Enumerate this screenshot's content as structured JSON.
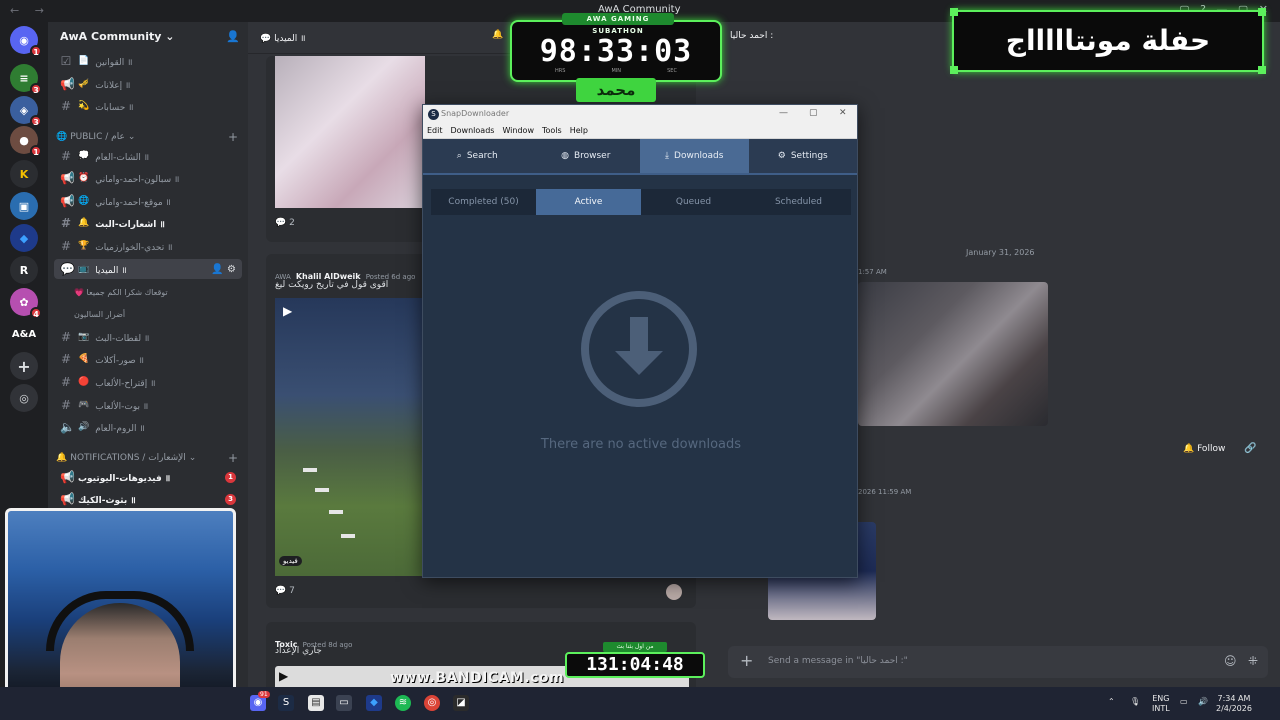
{
  "window": {
    "title": "AwA Community"
  },
  "rail": {
    "badges": [
      "1",
      "3",
      "3",
      "1",
      "4"
    ],
    "label": "A&A"
  },
  "sidebar": {
    "server_name": "AwA Community",
    "top_channels": [
      {
        "label": "القوانين ॥",
        "emoji": "📄"
      },
      {
        "label": "إعلانات ॥",
        "emoji": "🎺"
      },
      {
        "label": "حسابات ॥",
        "emoji": "💫"
      }
    ],
    "public_category": "PUBLIC / عام",
    "public_channels": [
      {
        "label": "الشات-العام ॥",
        "emoji": "💭"
      },
      {
        "label": "سبالون-احمد-واماني ॥",
        "emoji": "⏰"
      },
      {
        "label": "موقع-احمد-واماني ॥",
        "emoji": "🌐"
      },
      {
        "label": "اشعارات-البث ॥",
        "emoji": "🔔"
      },
      {
        "label": "تحدي-الخوارزميات ॥",
        "emoji": "🏆"
      },
      {
        "label": "الميديا ॥",
        "emoji": "📺"
      },
      {
        "label": "لقطات-البث ॥",
        "emoji": "📷"
      },
      {
        "label": "صور-أكلات ॥",
        "emoji": "🍕"
      },
      {
        "label": "إقتراح-الألعاب ॥",
        "emoji": "🔴"
      },
      {
        "label": "بوت-الألعاب ॥",
        "emoji": "🎮"
      },
      {
        "label": "الروم-العام ॥",
        "emoji": "🔊"
      }
    ],
    "threads": [
      "💗 توقعاك شكرا الكم جميعا",
      "أضرار الساليون"
    ],
    "notifications_category": "NOTIFICATIONS / الإشعارات",
    "notif_channels": [
      {
        "label": "فيديوهات-اليوتيوب ॥",
        "badge": "1"
      },
      {
        "label": "بثوث-الكيك ॥",
        "badge": "3"
      }
    ]
  },
  "main": {
    "header": "الميديا ॥",
    "post1": {
      "comments": "2"
    },
    "post2": {
      "author": "Khalil AlDweik",
      "tag": "AWA",
      "meta": "Posted 6d ago",
      "text": "اقوى قول في تاريخ رويكت ليغ",
      "video_badge": "فيديو",
      "comments": "7"
    },
    "post3": {
      "author": "Toxic",
      "meta": "Posted 8d ago",
      "text": "جاري الإعداد"
    }
  },
  "chat": {
    "header": "احمد حاليا :",
    "date_separator": "January 31, 2026",
    "time1": "1:57 AM",
    "time2": "2026 11:59 AM",
    "follow_label": "Follow",
    "compose_placeholder": "Send a message in \"احمد حاليا :\""
  },
  "snap": {
    "title": "SnapDownloader",
    "menu": [
      "Edit",
      "Downloads",
      "Window",
      "Tools",
      "Help"
    ],
    "tabs": [
      {
        "label": "Search",
        "icon": "search-icon",
        "glyph": "⌕"
      },
      {
        "label": "Browser",
        "icon": "globe-icon",
        "glyph": "◍"
      },
      {
        "label": "Downloads",
        "icon": "download-icon",
        "glyph": "⤓"
      },
      {
        "label": "Settings",
        "icon": "gear-icon",
        "glyph": "⚙"
      }
    ],
    "subtabs": [
      "Completed (50)",
      "Active",
      "Queued",
      "Scheduled"
    ],
    "empty_message": "There are no active downloads"
  },
  "overlay": {
    "subathon_label": "AWA GAMING SUBATHON",
    "subathon_time": "98:33:03",
    "units": [
      "HRS",
      "MIN",
      "SEC"
    ],
    "name_badge": "محمد",
    "party_text": "حفلة مونتاااااج",
    "counter_label": "من اول بثنا بث",
    "counter_time": "131:04:48",
    "watermark": "www.BANDICAM.com"
  },
  "taskbar": {
    "lang": "ENG",
    "layout": "INTL",
    "time": "7:34 AM",
    "date": "2/4/2026",
    "discord_badge": "91"
  }
}
